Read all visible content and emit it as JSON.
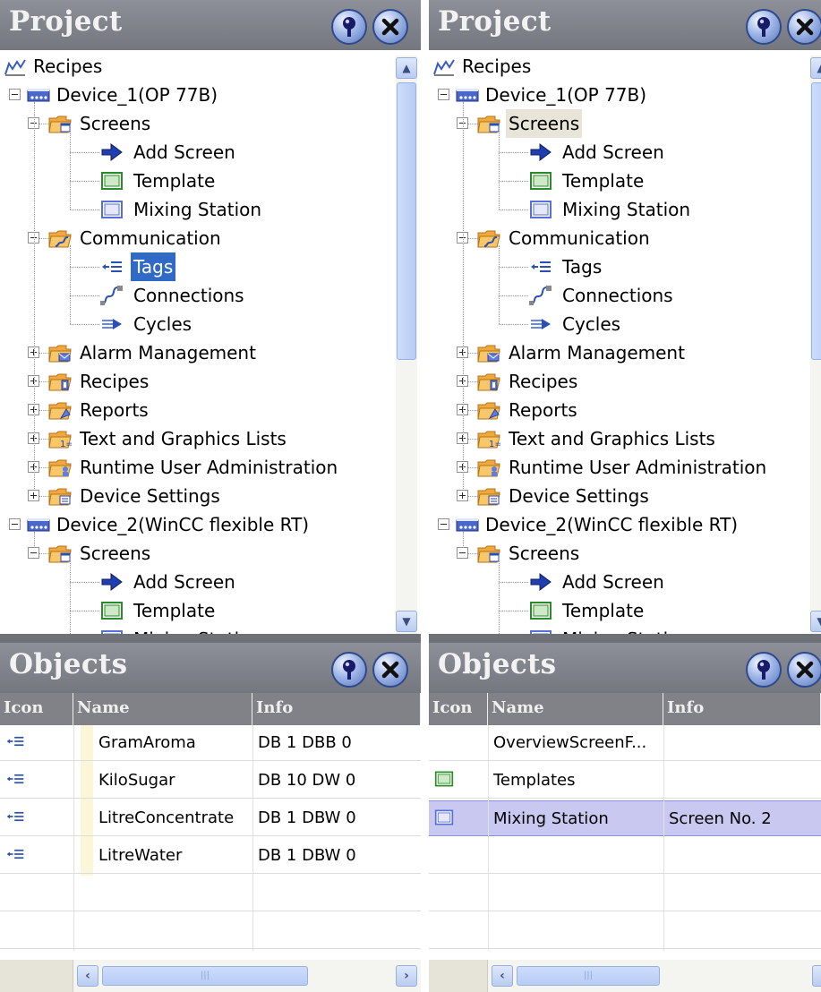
{
  "left": {
    "project_title": "Project",
    "objects_title": "Objects",
    "tree": [
      {
        "label": "Recipes",
        "icon": "recipes-project-icon",
        "depth": 0,
        "toggle": "none"
      },
      {
        "label": "Device_1(OP 77B)",
        "icon": "device-icon",
        "depth": 0,
        "toggle": "minus"
      },
      {
        "label": "Screens",
        "icon": "screens-folder-icon",
        "depth": 1,
        "toggle": "minus"
      },
      {
        "label": "Add Screen",
        "icon": "add-screen-icon",
        "depth": 2,
        "toggle": "none"
      },
      {
        "label": "Template",
        "icon": "template-screen-icon",
        "depth": 2,
        "toggle": "none"
      },
      {
        "label": "Mixing Station",
        "icon": "screen-icon",
        "depth": 2,
        "toggle": "none"
      },
      {
        "label": "Communication",
        "icon": "communication-folder-icon",
        "depth": 1,
        "toggle": "minus"
      },
      {
        "label": "Tags",
        "icon": "tags-icon",
        "depth": 2,
        "toggle": "none",
        "selected": true
      },
      {
        "label": "Connections",
        "icon": "connections-icon",
        "depth": 2,
        "toggle": "none"
      },
      {
        "label": "Cycles",
        "icon": "cycles-icon",
        "depth": 2,
        "toggle": "none"
      },
      {
        "label": "Alarm Management",
        "icon": "alarm-folder-icon",
        "depth": 1,
        "toggle": "plus"
      },
      {
        "label": "Recipes",
        "icon": "recipes-folder-icon",
        "depth": 1,
        "toggle": "plus"
      },
      {
        "label": "Reports",
        "icon": "reports-folder-icon",
        "depth": 1,
        "toggle": "plus"
      },
      {
        "label": "Text and Graphics Lists",
        "icon": "lists-folder-icon",
        "depth": 1,
        "toggle": "plus"
      },
      {
        "label": "Runtime User Administration",
        "icon": "user-admin-folder-icon",
        "depth": 1,
        "toggle": "plus"
      },
      {
        "label": "Device Settings",
        "icon": "device-settings-folder-icon",
        "depth": 1,
        "toggle": "plus"
      },
      {
        "label": "Device_2(WinCC flexible RT)",
        "icon": "device-icon",
        "depth": 0,
        "toggle": "minus"
      },
      {
        "label": "Screens",
        "icon": "screens-folder-icon",
        "depth": 1,
        "toggle": "minus"
      },
      {
        "label": "Add Screen",
        "icon": "add-screen-icon",
        "depth": 2,
        "toggle": "none"
      },
      {
        "label": "Template",
        "icon": "template-screen-icon",
        "depth": 2,
        "toggle": "none"
      },
      {
        "label": "Mixing Station",
        "icon": "screen-icon",
        "depth": 2,
        "toggle": "none"
      }
    ],
    "columns": [
      "Icon",
      "Name",
      "Info"
    ],
    "rows": [
      {
        "icon": "tags-icon",
        "name": "GramAroma",
        "info": "DB 1 DBB 0"
      },
      {
        "icon": "tags-icon",
        "name": "KiloSugar",
        "info": "DB 10 DW 0"
      },
      {
        "icon": "tags-icon",
        "name": "LitreConcentrate",
        "info": "DB 1 DBW 0"
      },
      {
        "icon": "tags-icon",
        "name": "LitreWater",
        "info": "DB 1 DBW 0"
      }
    ]
  },
  "right": {
    "project_title": "Project",
    "objects_title": "Objects",
    "tree": [
      {
        "label": "Recipes",
        "icon": "recipes-project-icon",
        "depth": 0,
        "toggle": "none"
      },
      {
        "label": "Device_1(OP 77B)",
        "icon": "device-icon",
        "depth": 0,
        "toggle": "minus"
      },
      {
        "label": "Screens",
        "icon": "screens-folder-icon",
        "depth": 1,
        "toggle": "minus",
        "highlighted": true
      },
      {
        "label": "Add Screen",
        "icon": "add-screen-icon",
        "depth": 2,
        "toggle": "none"
      },
      {
        "label": "Template",
        "icon": "template-screen-icon",
        "depth": 2,
        "toggle": "none"
      },
      {
        "label": "Mixing Station",
        "icon": "screen-icon",
        "depth": 2,
        "toggle": "none"
      },
      {
        "label": "Communication",
        "icon": "communication-folder-icon",
        "depth": 1,
        "toggle": "minus"
      },
      {
        "label": "Tags",
        "icon": "tags-icon",
        "depth": 2,
        "toggle": "none"
      },
      {
        "label": "Connections",
        "icon": "connections-icon",
        "depth": 2,
        "toggle": "none"
      },
      {
        "label": "Cycles",
        "icon": "cycles-icon",
        "depth": 2,
        "toggle": "none"
      },
      {
        "label": "Alarm Management",
        "icon": "alarm-folder-icon",
        "depth": 1,
        "toggle": "plus"
      },
      {
        "label": "Recipes",
        "icon": "recipes-folder-icon",
        "depth": 1,
        "toggle": "plus"
      },
      {
        "label": "Reports",
        "icon": "reports-folder-icon",
        "depth": 1,
        "toggle": "plus"
      },
      {
        "label": "Text and Graphics Lists",
        "icon": "lists-folder-icon",
        "depth": 1,
        "toggle": "plus"
      },
      {
        "label": "Runtime User Administration",
        "icon": "user-admin-folder-icon",
        "depth": 1,
        "toggle": "plus"
      },
      {
        "label": "Device Settings",
        "icon": "device-settings-folder-icon",
        "depth": 1,
        "toggle": "plus"
      },
      {
        "label": "Device_2(WinCC flexible RT)",
        "icon": "device-icon",
        "depth": 0,
        "toggle": "minus"
      },
      {
        "label": "Screens",
        "icon": "screens-folder-icon",
        "depth": 1,
        "toggle": "minus"
      },
      {
        "label": "Add Screen",
        "icon": "add-screen-icon",
        "depth": 2,
        "toggle": "none"
      },
      {
        "label": "Template",
        "icon": "template-screen-icon",
        "depth": 2,
        "toggle": "none"
      },
      {
        "label": "Mixing Station",
        "icon": "screen-icon",
        "depth": 2,
        "toggle": "none"
      }
    ],
    "columns": [
      "Icon",
      "Name",
      "Info"
    ],
    "rows": [
      {
        "icon": "",
        "name": "OverviewScreenF...",
        "info": ""
      },
      {
        "icon": "template-screen-icon",
        "name": "Templates",
        "info": ""
      },
      {
        "icon": "screen-icon",
        "name": "Mixing Station",
        "info": "Screen No. 2",
        "selected": true
      }
    ]
  },
  "icons": {
    "help": "help-pin-icon",
    "close": "close-icon",
    "scroll_up": "arrow-up-icon",
    "scroll_down": "arrow-down-icon",
    "scroll_left": "arrow-left-icon",
    "scroll_right": "arrow-right-icon"
  },
  "colors": {
    "titlebar": "#7f8188",
    "selection": "#316ac5",
    "row_selection": "#c8c8f0",
    "scroll_accent": "#b7cdf5"
  }
}
